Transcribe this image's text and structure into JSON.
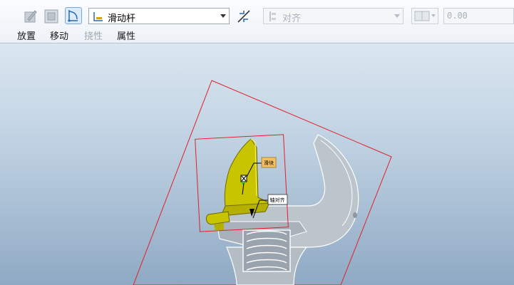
{
  "toolbar": {
    "connection_type": "滑动杆",
    "align_type": "对齐",
    "offset_value": "0.00",
    "tabs": {
      "placement": "放置",
      "move": "移动",
      "flexibility": "挠性",
      "properties": "属性"
    }
  },
  "viewport": {
    "component_label": "滑块",
    "axis_label": "轴对齐"
  },
  "colors": {
    "jaw": "#c8c400",
    "wrench": "#b9c1c9",
    "bounding_box": "#e0202a",
    "tag_bg": "#f6c060"
  }
}
